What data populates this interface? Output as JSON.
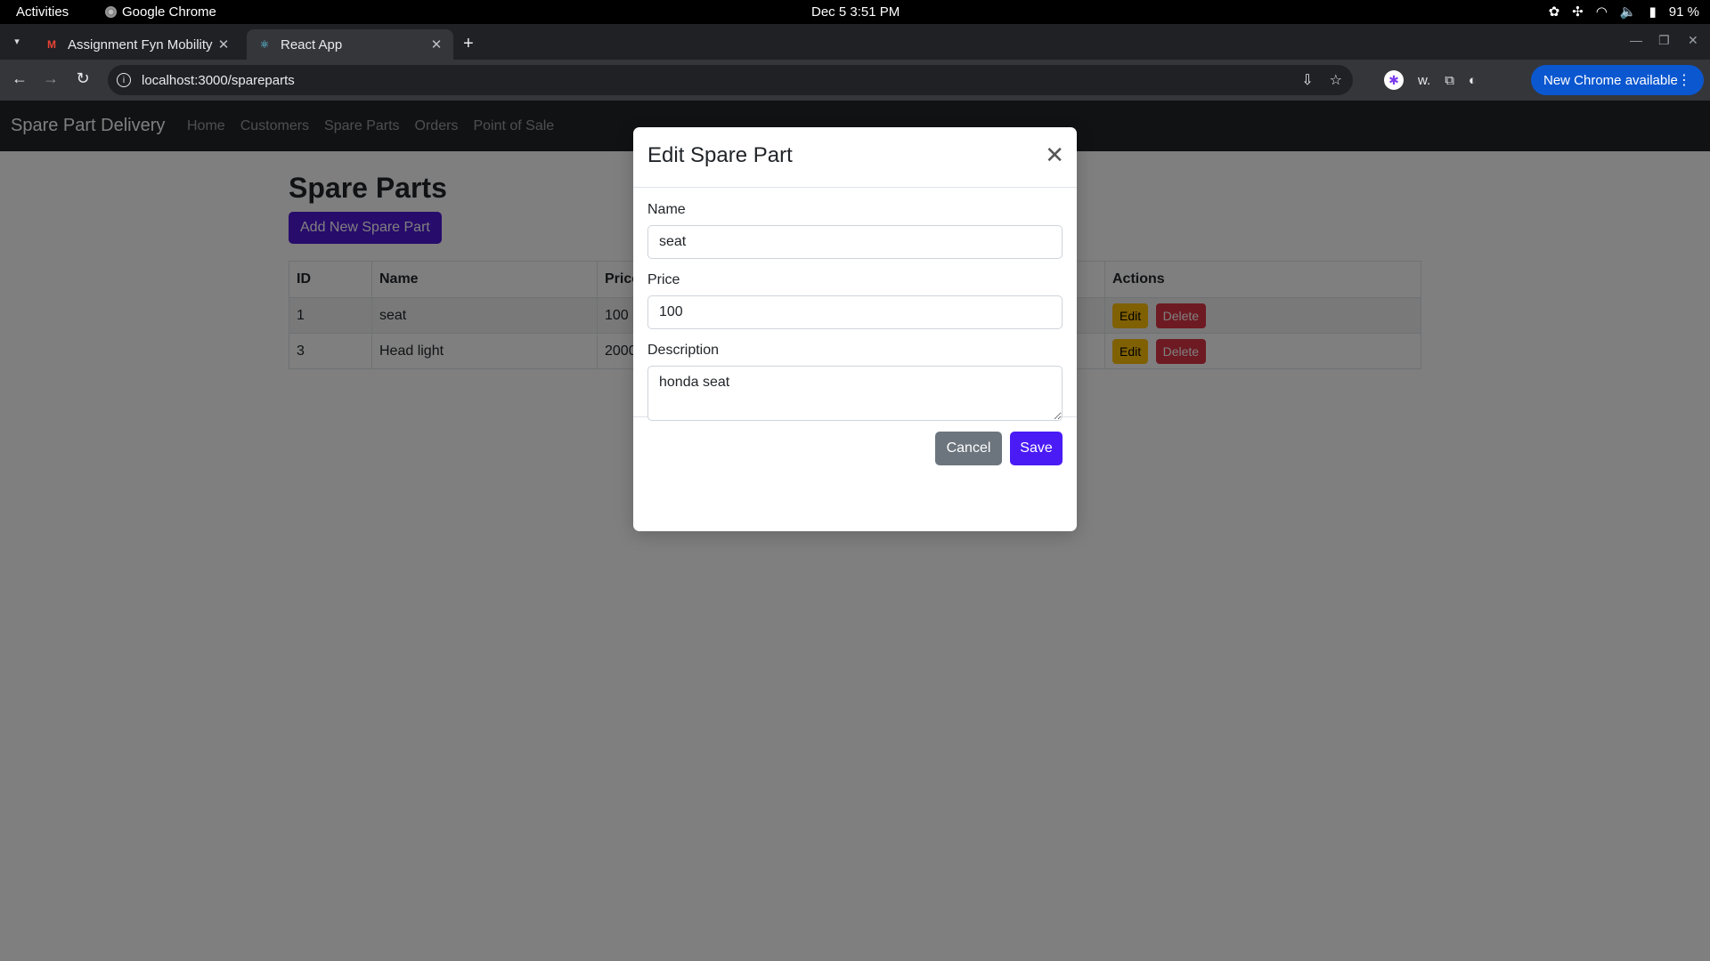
{
  "system": {
    "activities": "Activities",
    "app_name": "Google Chrome",
    "clock": "Dec 5  3:51 PM",
    "battery": "91 %"
  },
  "browser": {
    "tabs": [
      {
        "title": "Assignment Fyn Mobility",
        "favicon": "gmail-icon"
      },
      {
        "title": "React App",
        "favicon": "react-icon"
      }
    ],
    "url": "localhost:3000/spareparts",
    "update_label": "New Chrome available"
  },
  "app": {
    "brand": "Spare Part Delivery",
    "nav": [
      "Home",
      "Customers",
      "Spare Parts",
      "Orders",
      "Point of Sale"
    ],
    "page_title": "Spare Parts",
    "add_button": "Add New Spare Part",
    "table": {
      "headers": [
        "ID",
        "Name",
        "Price",
        "Actions"
      ],
      "rows": [
        {
          "id": "1",
          "name": "seat",
          "price": "100"
        },
        {
          "id": "3",
          "name": "Head light",
          "price": "2000"
        }
      ],
      "edit_label": "Edit",
      "delete_label": "Delete"
    }
  },
  "modal": {
    "title": "Edit Spare Part",
    "name_label": "Name",
    "name_value": "seat",
    "price_label": "Price",
    "price_value": "100",
    "description_label": "Description",
    "description_value": "honda seat",
    "cancel_label": "Cancel",
    "save_label": "Save"
  },
  "colors": {
    "primary": "#4f19d6",
    "save": "#4a1bf5",
    "cancel": "#6c757d",
    "edit": "#ffc107",
    "delete": "#dc3545",
    "chrome_update": "#0b57d0"
  }
}
